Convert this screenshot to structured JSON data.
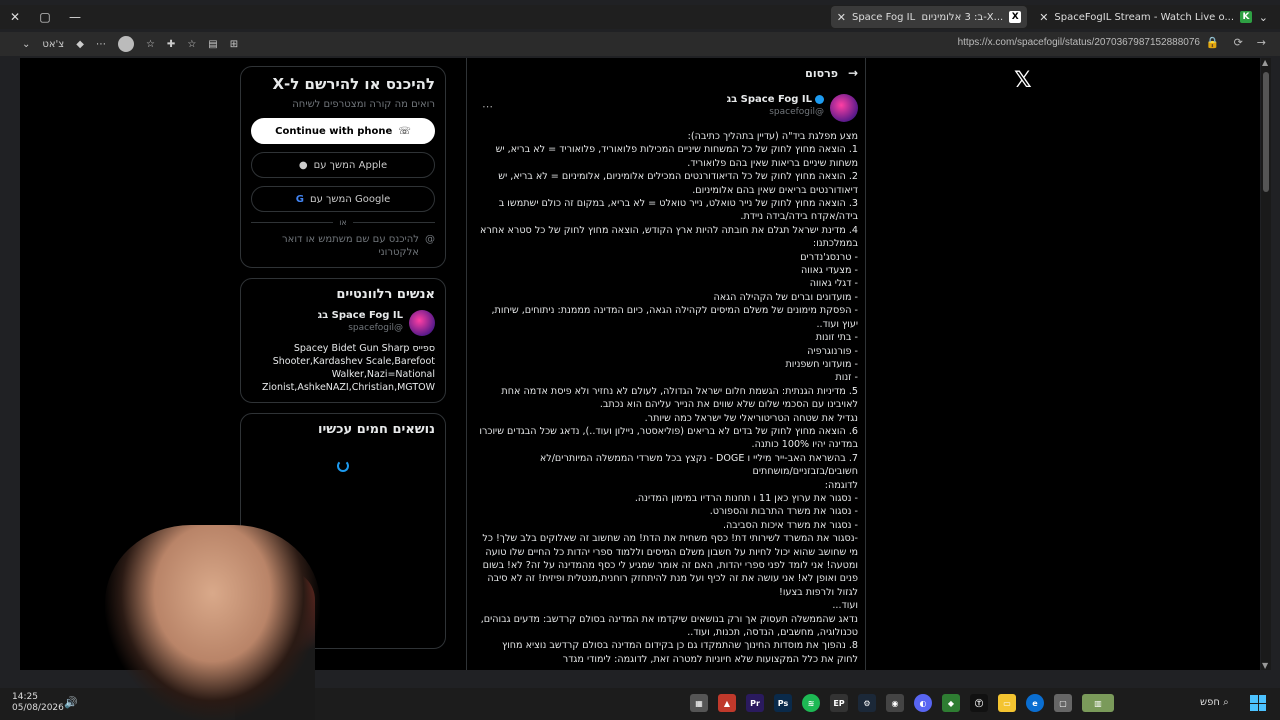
{
  "window": {
    "tabs": [
      {
        "label": "Space Fog IL ב: 3 אלומיניום ‏-X‏...",
        "active": true
      },
      {
        "label": "SpaceFogIL Stream - Watch Live o...",
        "active": false
      }
    ],
    "url": "https://x.com/spacefogil/status/2070367987152888076",
    "addr_left_label": "צ'אט"
  },
  "login_card": {
    "title": "להיכנס או להירשם ל-X",
    "subtitle": "רואים מה קורה ומצטרפים לשיחה",
    "phone_btn": "Continue with phone",
    "apple_btn": "המשך עם Apple",
    "google_btn": "המשך עם Google",
    "or": "או",
    "alt_login": "להיכנס עם שם משתמש או דואר אלקטרוני"
  },
  "relevant": {
    "title": "אנשים רלוונטיים",
    "name": "Space Fog IL ‏בג",
    "handle": "@spacefogil",
    "bio": "ספייס Spacey Bidet Gun Sharp Shooter,Kardashev Scale,Barefoot Walker,Nazi=National Zionist,AshkeNAZI,Christian,MGTOW"
  },
  "trending": {
    "title": "נושאים חמים עכשיו"
  },
  "post": {
    "header": "פרסום",
    "author_name": "Space Fog IL ‏בג",
    "author_handle": "@spacefogil",
    "body": "מצע מפלגת ביד\"ה (עדיין בתהליך כתיבה):\n1. הוצאה מחוץ לחוק של כל המשחות שיניים המכילות פלואוריד, פלואוריד = לא בריא, יש משחות שיניים בריאות שאין בהם פלואוריד.\n2. הוצאה מחוץ לחוק של כל הדיאודורנטים המכילים אלומיניום, אלומיניום = לא בריא, יש דיאודורנטים בריאים שאין בהם אלומיניום.\n3. הוצאה מחוץ לחוק של נייר טואלט, נייר טואלט = לא בריא, במקום זה כולם ישתמשו ב בידה/אקדח בידה/בידה ניידת.\n4. מדינת ישראל תגלם את חובתה להיות ארץ הקודש, הוצאה מחוץ לחוק של כל סטרא אחרא בממלכתנו:\n- טרנסג'נדרים\n- מצעדי גאווה\n- דגלי גאווה\n- מועדונים וברים של הקהילה הגאה\n- הפסקת מימונים של משלם המיסים לקהילה הגאה, כיום המדינה מממנת: ניתוחים, שיחות, יעוץ ועוד..\n- בתי זונות\n- פורנוגרפיה\n- מועדוני חשפניות\n- זנות\n5. מדיניות הגנתית: הגשמת חלום ישראל הגדולה, לעולם לא נחזיר ולא פיסת אדמה אחת לאויבינו עם הסכמי שלום שלא שווים את הנייר עליהם הוא נכתב.\nנגדיל את שטחה הטריטוריאלי של ישראל כמה שיותר.\n6. הוצאה מחוץ לחוק של בדים לא בריאים (פוליאסטר, ניילון ועוד..), נדאג שכל הבגדים שיוכרו במדינה יהיו 100% כותנה.\n7. בהשראת האב-ייר מיליי ו DOGE - נקצץ בכל משרדי הממשלה המיותרים/לא חשובים/בזבזניים/מושחתים\nלדוגמה:\n- נסגור את ערוץ כאן 11 ו תחנות הרדיו במימון המדינה.\n- נסגור את משרד התרבות והספורט.\n- נסגור את משרד איכות הסביבה.\n-נסגור את המשרד לשירותי דת! כסף משחית את הדת! מה שחשוב זה שאלוקים בלב שלך! כל מי שחושב שהוא יכול לחיות על חשבון משלם המיסים וללמוד ספרי יהדות כל החיים שלו טועה ומטעה! אני לומד לפני ספרי יהדות, האם זה אומר שמגיע לי כסף מהמדינה על זה? לא! בשום פנים ואופן לא! אני עושה את זה לכיף ועל מנת להיתחזק רוחנית,מנטלית ופיזית! זה לא סיבה לגזול ולרפות בצעו!\nועוד...\nנדאג שהממשלה תעסוק אך ורק בנושאים שיקדמו את המדינה בסולם קרדשב: מדעים גבוהים, טכנולוגיה, מחשבים, הנדסה, תכנות, ועוד..\n8. נהפוך את מוסדות החינוך שהתמקדו גם כן בקידום המדינה בסולם קרדשב נוציא מחוץ לחוק את כלל המקצועות שלא חיוניות למטרה זאת, לדוגמה: לימודי מגדר"
  },
  "taskbar": {
    "time": "14:25",
    "date": "05/08/2026",
    "search": "חפש"
  }
}
